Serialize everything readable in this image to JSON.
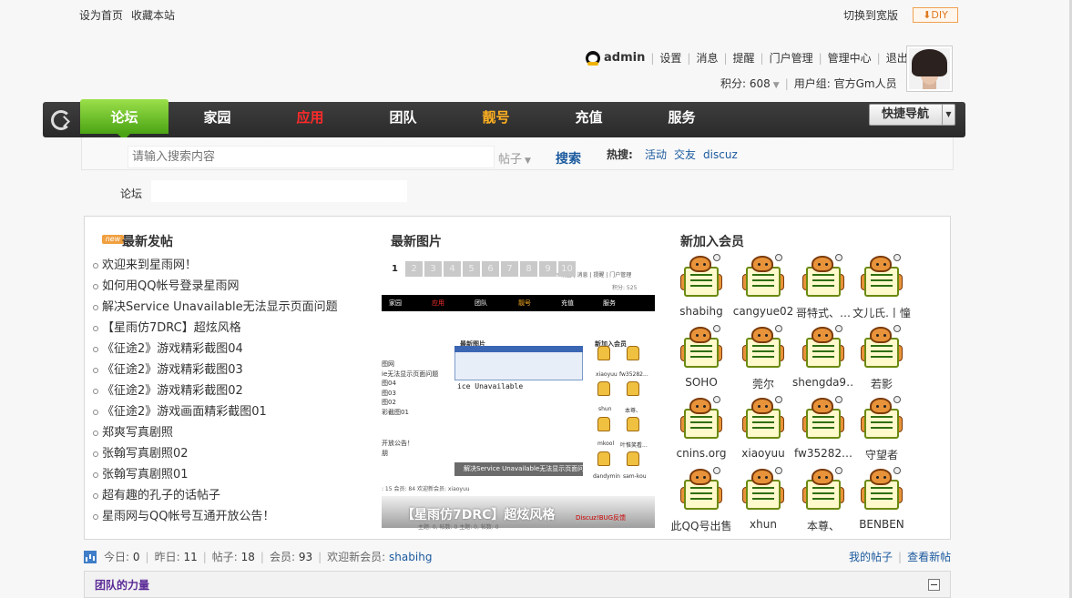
{
  "topbar": {
    "set_home": "设为首页",
    "bookmark": "收藏本站",
    "wide": "切换到宽版",
    "diy": "DIY"
  },
  "user": {
    "name": "admin",
    "links": [
      "设置",
      "消息",
      "提醒",
      "门户管理",
      "管理中心",
      "退出"
    ],
    "points": "积分: 608",
    "group": "用户组: 官方Gm人员"
  },
  "nav": {
    "items": [
      "论坛",
      "家园",
      "应用",
      "团队",
      "靓号",
      "充值",
      "服务"
    ],
    "colors": [
      "#ffffff",
      "#ffffff",
      "#ff2a2a",
      "#ffffff",
      "#ffb020",
      "#ffffff",
      "#ffffff"
    ],
    "quick_nav": "快捷导航"
  },
  "search": {
    "placeholder": "请输入搜索内容",
    "type": "帖子",
    "button": "搜索",
    "hot_label": "热搜:",
    "hot_links": [
      "活动",
      "交友",
      "discuz"
    ]
  },
  "breadcrumb": {
    "label": "论坛"
  },
  "latest_posts": {
    "title": "最新发帖",
    "badge": "new",
    "items": [
      "欢迎来到星雨网！",
      "如何用QQ帐号登录星雨网",
      "解决Service Unavailable无法显示页面问题",
      "【星雨仿7DRC】超炫风格",
      "《征途2》游戏精彩截图04",
      "《征途2》游戏精彩截图03",
      "《征途2》游戏精彩截图02",
      "《征途2》游戏画面精彩截图01",
      "郑爽写真剧照",
      "张翰写真剧照02",
      "张翰写真剧照01",
      "超有趣的孔子的话帖子",
      "星雨网与QQ帐号互通开放公告！"
    ]
  },
  "latest_images": {
    "title": "最新图片",
    "pages": [
      "1",
      "2",
      "3",
      "4",
      "5",
      "6",
      "7",
      "8",
      "9",
      "10"
    ],
    "current_page": "1",
    "caption": "【星雨仿7DRC】超炫风格",
    "thumb": {
      "toplinks": "admin 设置 | 消息 | 提醒 | 门户管理",
      "credit": "积分: 525",
      "nav": [
        "家园",
        "应用",
        "团队",
        "靓号",
        "充值",
        "服务"
      ],
      "heading_images": "最新图片",
      "heading_members": "新加入会员",
      "side_list": [
        "图网",
        "ie无法显示页面问题",
        "图04",
        "图03",
        "图02",
        "彩截图01"
      ],
      "inner_text": "ice Unavailable",
      "overlay": "解决Service Unavailable无法显示页面问题",
      "mini_members": [
        "xiaoyuu",
        "fw35282...",
        "shun",
        "本尊、",
        "mkool",
        "叶惟笑看...",
        "dandymin",
        "sam-kou"
      ],
      "side_extra": [
        "开放公告！",
        "朋"
      ],
      "footer": ": 15  会员: 84  欢迎新会员: xiaoyuu",
      "caption_small1": "Discuz!BUG反馈",
      "caption_small2": "主题: 0, 帖数: 0    主题: 0, 帖数: 0"
    }
  },
  "new_members": {
    "title": "新加入会员",
    "items": [
      "shabihg",
      "cangyue02",
      "哥特式、…",
      "文儿氏.丨憧",
      "SOHO",
      "莞尔",
      "shengda9…",
      "若影",
      "cnins.org",
      "xiaoyuu",
      "fw35282…",
      "守望者",
      "此QQ号出售",
      "xhun",
      "本尊、",
      "BENBEN"
    ]
  },
  "stats": {
    "today_label": "今日:",
    "today": "0",
    "yesterday_label": "昨日:",
    "yesterday": "11",
    "posts_label": "帖子:",
    "posts": "18",
    "members_label": "会员:",
    "members": "93",
    "welcome_label": "欢迎新会员:",
    "welcome_user": "shabihg"
  },
  "my_links": {
    "my_posts": "我的帖子",
    "view_new": "查看新帖"
  },
  "team": {
    "title": "团队的力量"
  }
}
